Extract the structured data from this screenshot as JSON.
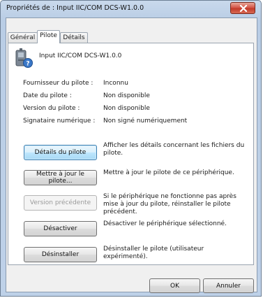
{
  "window": {
    "title": "Propriétés de : Input IIC/COM DCS-W1.0.0"
  },
  "tabs": [
    {
      "label": "Général",
      "active": false
    },
    {
      "label": "Pilote",
      "active": true
    },
    {
      "label": "Détails",
      "active": false
    }
  ],
  "device": {
    "icon": "input-device-icon",
    "name": "Input IIC/COM DCS-W1.0.0"
  },
  "properties": [
    {
      "label": "Fournisseur du pilote :",
      "value": "Inconnu"
    },
    {
      "label": "Date du pilote :",
      "value": "Non disponible"
    },
    {
      "label": "Version du pilote :",
      "value": "Non disponible"
    },
    {
      "label": "Signataire numérique :",
      "value": "Non signé numériquement"
    }
  ],
  "actions": [
    {
      "label": "Détails du pilote",
      "description": "Afficher les détails concernant les fichiers du pilote.",
      "enabled": true,
      "focused": true
    },
    {
      "label": "Mettre à jour le pilote...",
      "description": "Mettre à jour le pilote de ce périphérique.",
      "enabled": true,
      "focused": false
    },
    {
      "label": "Version précédente",
      "description": "Si le périphérique ne fonctionne pas après mise à jour du pilote, réinstaller le pilote précédent.",
      "enabled": false,
      "focused": false
    },
    {
      "label": "Désactiver",
      "description": "Désactiver le périphérique sélectionné.",
      "enabled": true,
      "focused": false
    },
    {
      "label": "Désinstaller",
      "description": "Désinstaller le pilote (utilisateur expérimenté).",
      "enabled": true,
      "focused": false
    }
  ],
  "footer": {
    "ok_label": "OK",
    "cancel_label": "Annuler"
  },
  "colors": {
    "close_button": "#c23a2a",
    "focus_accent": "#3c7fb1"
  }
}
